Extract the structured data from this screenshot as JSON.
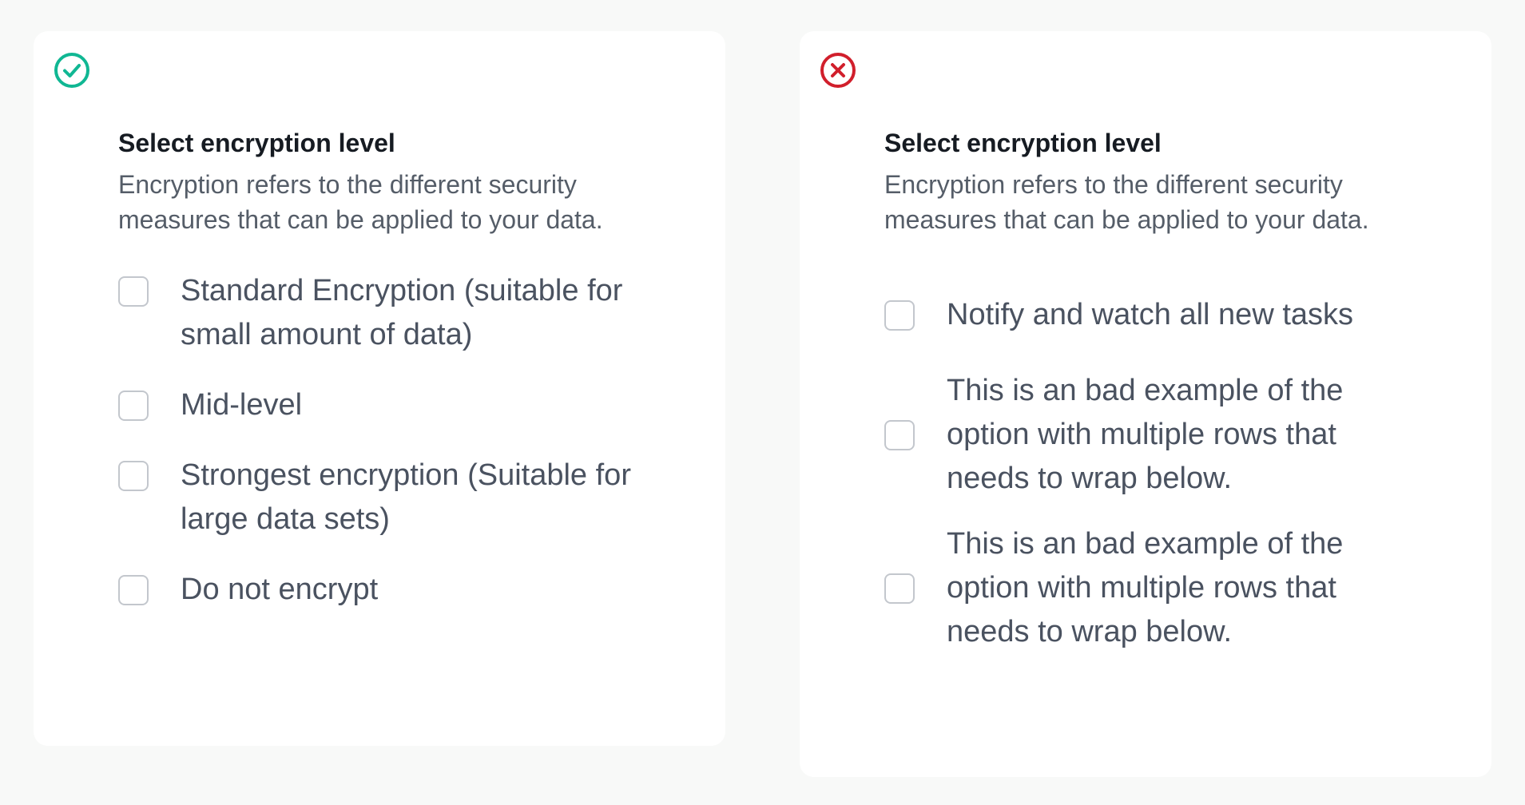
{
  "colors": {
    "good_accent": "#10b793",
    "bad_accent": "#d11f2c",
    "page_background": "#f8f9f8",
    "card_background": "#ffffff"
  },
  "good_example": {
    "status_icon": "check-circle-icon",
    "title": "Select encryption level",
    "description": "Encryption refers to the different security measures that can be applied to your data.",
    "options": [
      {
        "label": "Standard Encryption (suitable for small amount of data)",
        "checked": false
      },
      {
        "label": "Mid-level",
        "checked": false
      },
      {
        "label": "Strongest encryption (Suitable for large data sets)",
        "checked": false
      },
      {
        "label": "Do not encrypt",
        "checked": false
      }
    ]
  },
  "bad_example": {
    "status_icon": "x-circle-icon",
    "title": "Select encryption level",
    "description": "Encryption refers to the different security measures that can be applied to your data.",
    "options": [
      {
        "label": "Notify and watch all new tasks",
        "checked": false
      },
      {
        "label": "This is an bad example of the option with multiple rows that needs to wrap below.",
        "checked": false
      },
      {
        "label": "This is an bad example of the option with multiple rows that needs to wrap below.",
        "checked": false
      }
    ]
  }
}
